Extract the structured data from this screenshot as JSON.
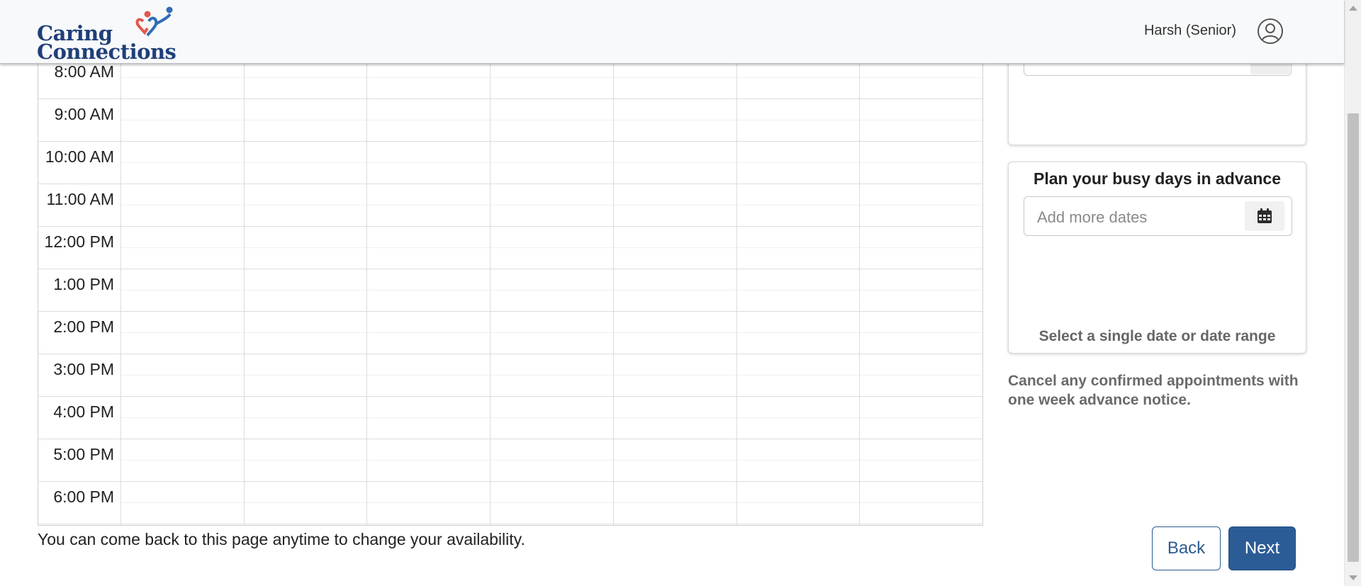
{
  "header": {
    "logo_line1": "Caring",
    "logo_line2": "Connections",
    "user_name": "Harsh (Senior)",
    "user_icon": "user-circle-icon"
  },
  "schedule": {
    "times": [
      "8:00 AM",
      "9:00 AM",
      "10:00 AM",
      "11:00 AM",
      "12:00 PM",
      "1:00 PM",
      "2:00 PM",
      "3:00 PM",
      "4:00 PM",
      "5:00 PM",
      "6:00 PM"
    ],
    "footer_note": "You can come back to this page anytime to change your availability."
  },
  "busy_days": {
    "title": "Plan your busy days in advance",
    "date_input_placeholder": "Add more dates",
    "calendar_icon": "calendar-icon",
    "hint": "Select a single date or date range"
  },
  "cancel_note": "Cancel any confirmed appointments with one week advance notice.",
  "buttons": {
    "back": "Back",
    "next": "Next"
  },
  "colors": {
    "brand_blue": "#2c5c96",
    "logo_navy": "#1f3f7a",
    "heart_red": "#e2574c",
    "heart_blue": "#2f6db5"
  }
}
